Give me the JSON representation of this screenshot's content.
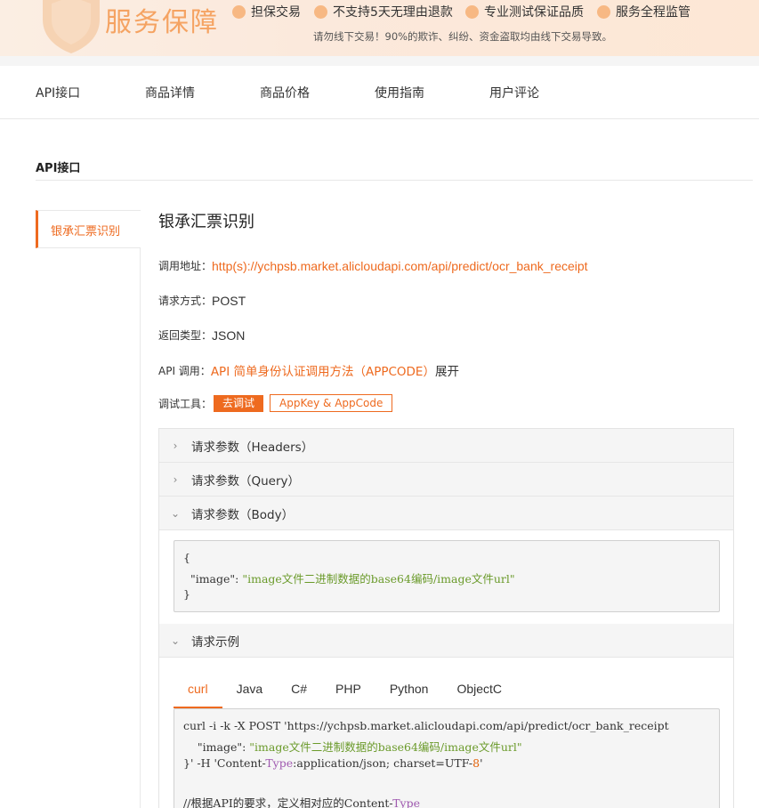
{
  "banner": {
    "title": "服务保障",
    "features": [
      "担保交易",
      "不支持5天无理由退款",
      "专业测试保证品质",
      "服务全程监管"
    ],
    "notice": "请勿线下交易！90%的欺诈、纠纷、资金盗取均由线下交易导致。"
  },
  "nav": {
    "tabs": [
      "API接口",
      "商品详情",
      "商品价格",
      "使用指南",
      "用户评论"
    ]
  },
  "section": {
    "title": "API接口"
  },
  "side": {
    "items": [
      "银承汇票识别"
    ]
  },
  "api": {
    "title": "银承汇票识别",
    "url_label": "调用地址：",
    "url": "http(s)://ychpsb.market.alicloudapi.com/api/predict/ocr_bank_receipt",
    "method_label": "请求方式：",
    "method": "POST",
    "return_label": "返回类型：",
    "return_type": "JSON",
    "call_label": "API 调用：",
    "call_link": "API 简单身份认证调用方法（APPCODE）",
    "call_expand": "展开",
    "tool_label": "调试工具：",
    "debug_button": "去调试",
    "appkey_button": "AppKey & AppCode"
  },
  "accordion": {
    "headers_label": "请求参数（Headers）",
    "query_label": "请求参数（Query）",
    "body_label": "请求参数（Body）",
    "body_code": {
      "open": "{",
      "key": "\"image\"",
      "colon": ": ",
      "value": "\"image文件二进制数据的base64编码/image文件url\"",
      "close": "}"
    },
    "example_label": "请求示例"
  },
  "lang_tabs": [
    "curl",
    "Java",
    "C#",
    "PHP",
    "Python",
    "ObjectC"
  ],
  "example_code": {
    "line1": "curl -i -k -X POST 'https://ychpsb.market.alicloudapi.com/api/predict/ocr_bank_receipt",
    "line2_key": "\"image\"",
    "line2_colon": ": ",
    "line2_val": "\"image文件二进制数据的base64编码/image文件url\"",
    "line3_a": "}' -H 'Content-",
    "line3_type": "Type",
    "line3_b": ":application/json; charset=UTF-",
    "line3_num": "8",
    "line3_c": "'",
    "line5_a": "//根据API的要求，定义相对应的Content-",
    "line5_type": "Type"
  },
  "colors": {
    "accent": "#ee6a1f",
    "banner_title": "#f5a362",
    "code_string": "#6a9a2a"
  },
  "icons": [
    "shield-icon",
    "feature-dot-icon",
    "chevron-right-icon",
    "chevron-down-icon"
  ]
}
